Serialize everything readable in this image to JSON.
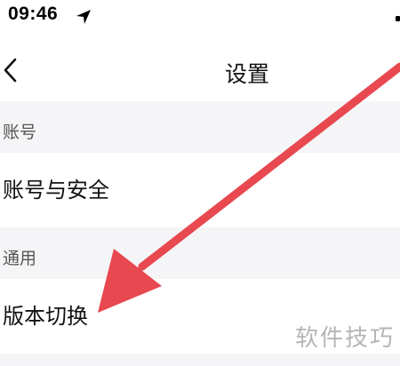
{
  "status_bar": {
    "time": "09:46"
  },
  "nav": {
    "title": "设置"
  },
  "sections": [
    {
      "header": "账号",
      "items": [
        {
          "label": "账号与安全"
        }
      ]
    },
    {
      "header": "通用",
      "items": [
        {
          "label": "版本切换"
        }
      ]
    }
  ],
  "watermark": "软件技巧",
  "annotation": {
    "arrow_color": "#e8484f"
  },
  "icons": {
    "location": "location-arrow-icon",
    "back": "chevron-left-icon"
  }
}
